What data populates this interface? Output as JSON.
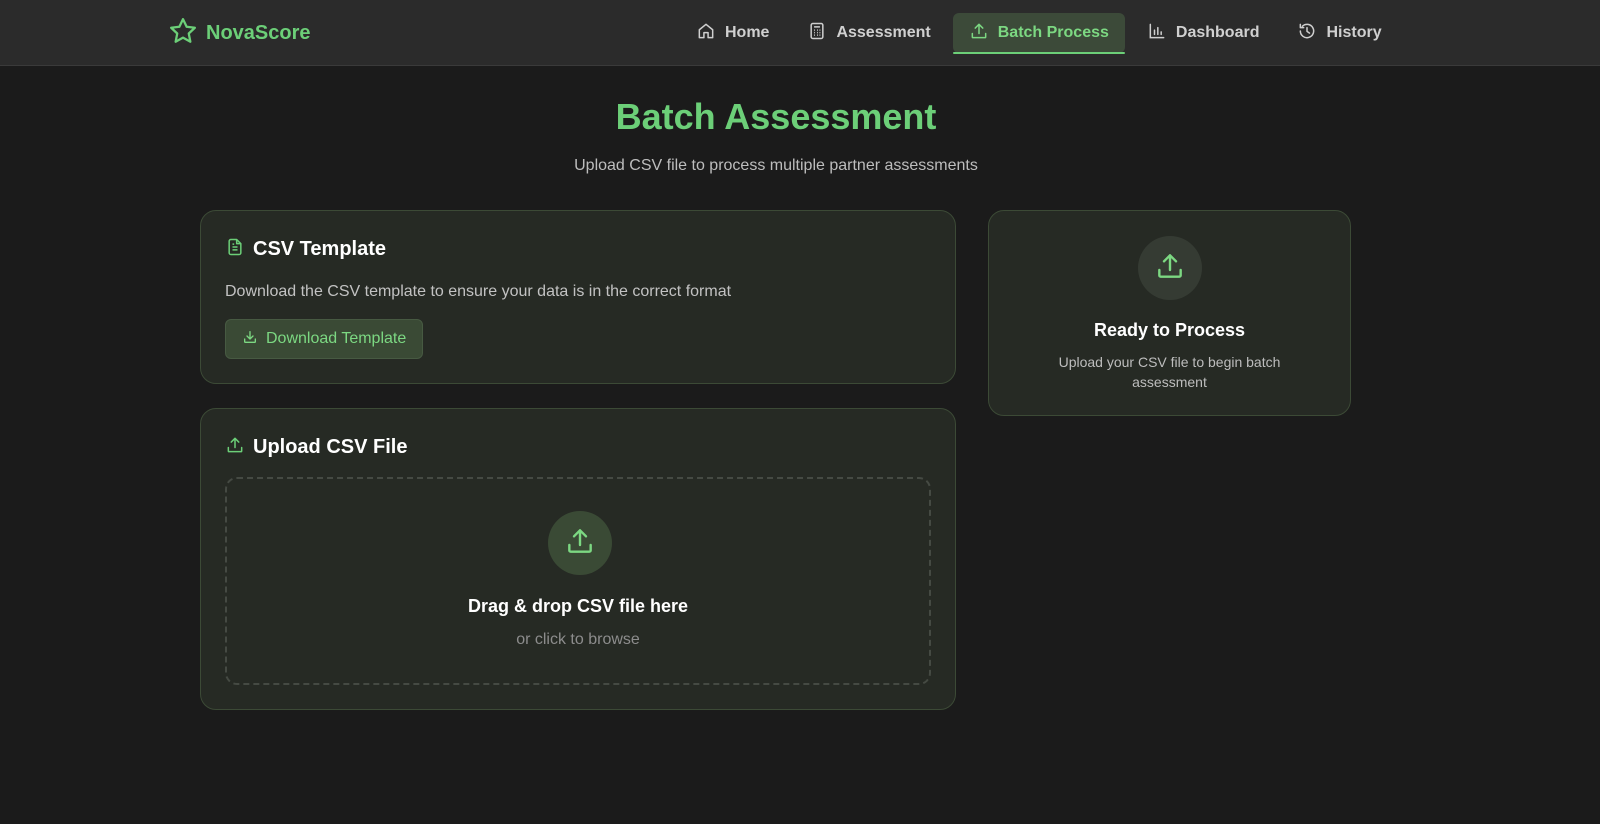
{
  "brand": {
    "name": "NovaScore",
    "icon": "star-icon"
  },
  "nav": {
    "items": [
      {
        "label": "Home",
        "icon": "home-icon",
        "active": false
      },
      {
        "label": "Assessment",
        "icon": "calculator-icon",
        "active": false
      },
      {
        "label": "Batch Process",
        "icon": "upload-icon",
        "active": true
      },
      {
        "label": "Dashboard",
        "icon": "bar-chart-icon",
        "active": false
      },
      {
        "label": "History",
        "icon": "history-icon",
        "active": false
      }
    ]
  },
  "page": {
    "title": "Batch Assessment",
    "subtitle": "Upload CSV file to process multiple partner assessments"
  },
  "template_card": {
    "title": "CSV Template",
    "icon": "file-text-icon",
    "description": "Download the CSV template to ensure your data is in the correct format",
    "button_label": "Download Template",
    "button_icon": "download-icon"
  },
  "upload_card": {
    "title": "Upload CSV File",
    "icon": "upload-icon",
    "dropzone_title": "Drag & drop CSV file here",
    "dropzone_subtitle": "or click to browse"
  },
  "status_card": {
    "title": "Ready to Process",
    "description": "Upload your CSV file to begin batch assessment",
    "icon": "upload-icon"
  },
  "colors": {
    "accent": "#6ccf78",
    "background": "#1b1b1b",
    "card": "#262a24",
    "navbar": "#2b2b2b"
  }
}
